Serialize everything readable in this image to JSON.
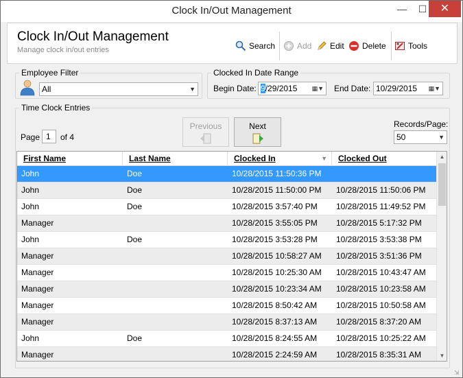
{
  "window": {
    "title": "Clock In/Out Management"
  },
  "header": {
    "title": "Clock In/Out Management",
    "subtitle": "Manage clock in/out entries",
    "toolbar": {
      "search": "Search",
      "add": "Add",
      "edit": "Edit",
      "delete": "Delete",
      "tools": "Tools"
    }
  },
  "employee_filter": {
    "label": "Employee Filter",
    "value": "All"
  },
  "date_range": {
    "label": "Clocked In Date Range",
    "begin_label": "Begin Date:",
    "begin_sel": "9",
    "begin_rest": "/29/2015",
    "end_label": "End Date:",
    "end_value": "10/29/2015"
  },
  "entries": {
    "label": "Time Clock Entries",
    "page_label": "Page",
    "page_value": "1",
    "of_label": "of 4",
    "previous": "Previous",
    "next": "Next",
    "records_label": "Records/Page:",
    "records_value": "50"
  },
  "grid": {
    "columns": [
      "First Name",
      "Last Name",
      "Clocked In",
      "Clocked Out"
    ],
    "rows": [
      [
        "John",
        "Doe",
        "10/28/2015 11:50:36 PM",
        ""
      ],
      [
        "John",
        "Doe",
        "10/28/2015 11:50:00 PM",
        "10/28/2015 11:50:06 PM"
      ],
      [
        "John",
        "Doe",
        "10/28/2015 3:57:40 PM",
        "10/28/2015 11:49:52 PM"
      ],
      [
        "Manager",
        "",
        "10/28/2015 3:55:05 PM",
        "10/28/2015 5:17:32 PM"
      ],
      [
        "John",
        "Doe",
        "10/28/2015 3:53:28 PM",
        "10/28/2015 3:53:38 PM"
      ],
      [
        "Manager",
        "",
        "10/28/2015 10:58:27 AM",
        "10/28/2015 3:51:36 PM"
      ],
      [
        "Manager",
        "",
        "10/28/2015 10:25:30 AM",
        "10/28/2015 10:43:47 AM"
      ],
      [
        "Manager",
        "",
        "10/28/2015 10:23:34 AM",
        "10/28/2015 10:23:58 AM"
      ],
      [
        "Manager",
        "",
        "10/28/2015 8:50:42 AM",
        "10/28/2015 10:50:58 AM"
      ],
      [
        "Manager",
        "",
        "10/28/2015 8:37:13 AM",
        "10/28/2015 8:37:20 AM"
      ],
      [
        "John",
        "Doe",
        "10/28/2015 8:24:55 AM",
        "10/28/2015 10:25:22 AM"
      ],
      [
        "Manager",
        "",
        "10/28/2015 2:24:59 AM",
        "10/28/2015 8:35:31 AM"
      ]
    ],
    "selected_row": 0
  },
  "colors": {
    "selection": "#3399ff",
    "close_button": "#c7403a"
  }
}
